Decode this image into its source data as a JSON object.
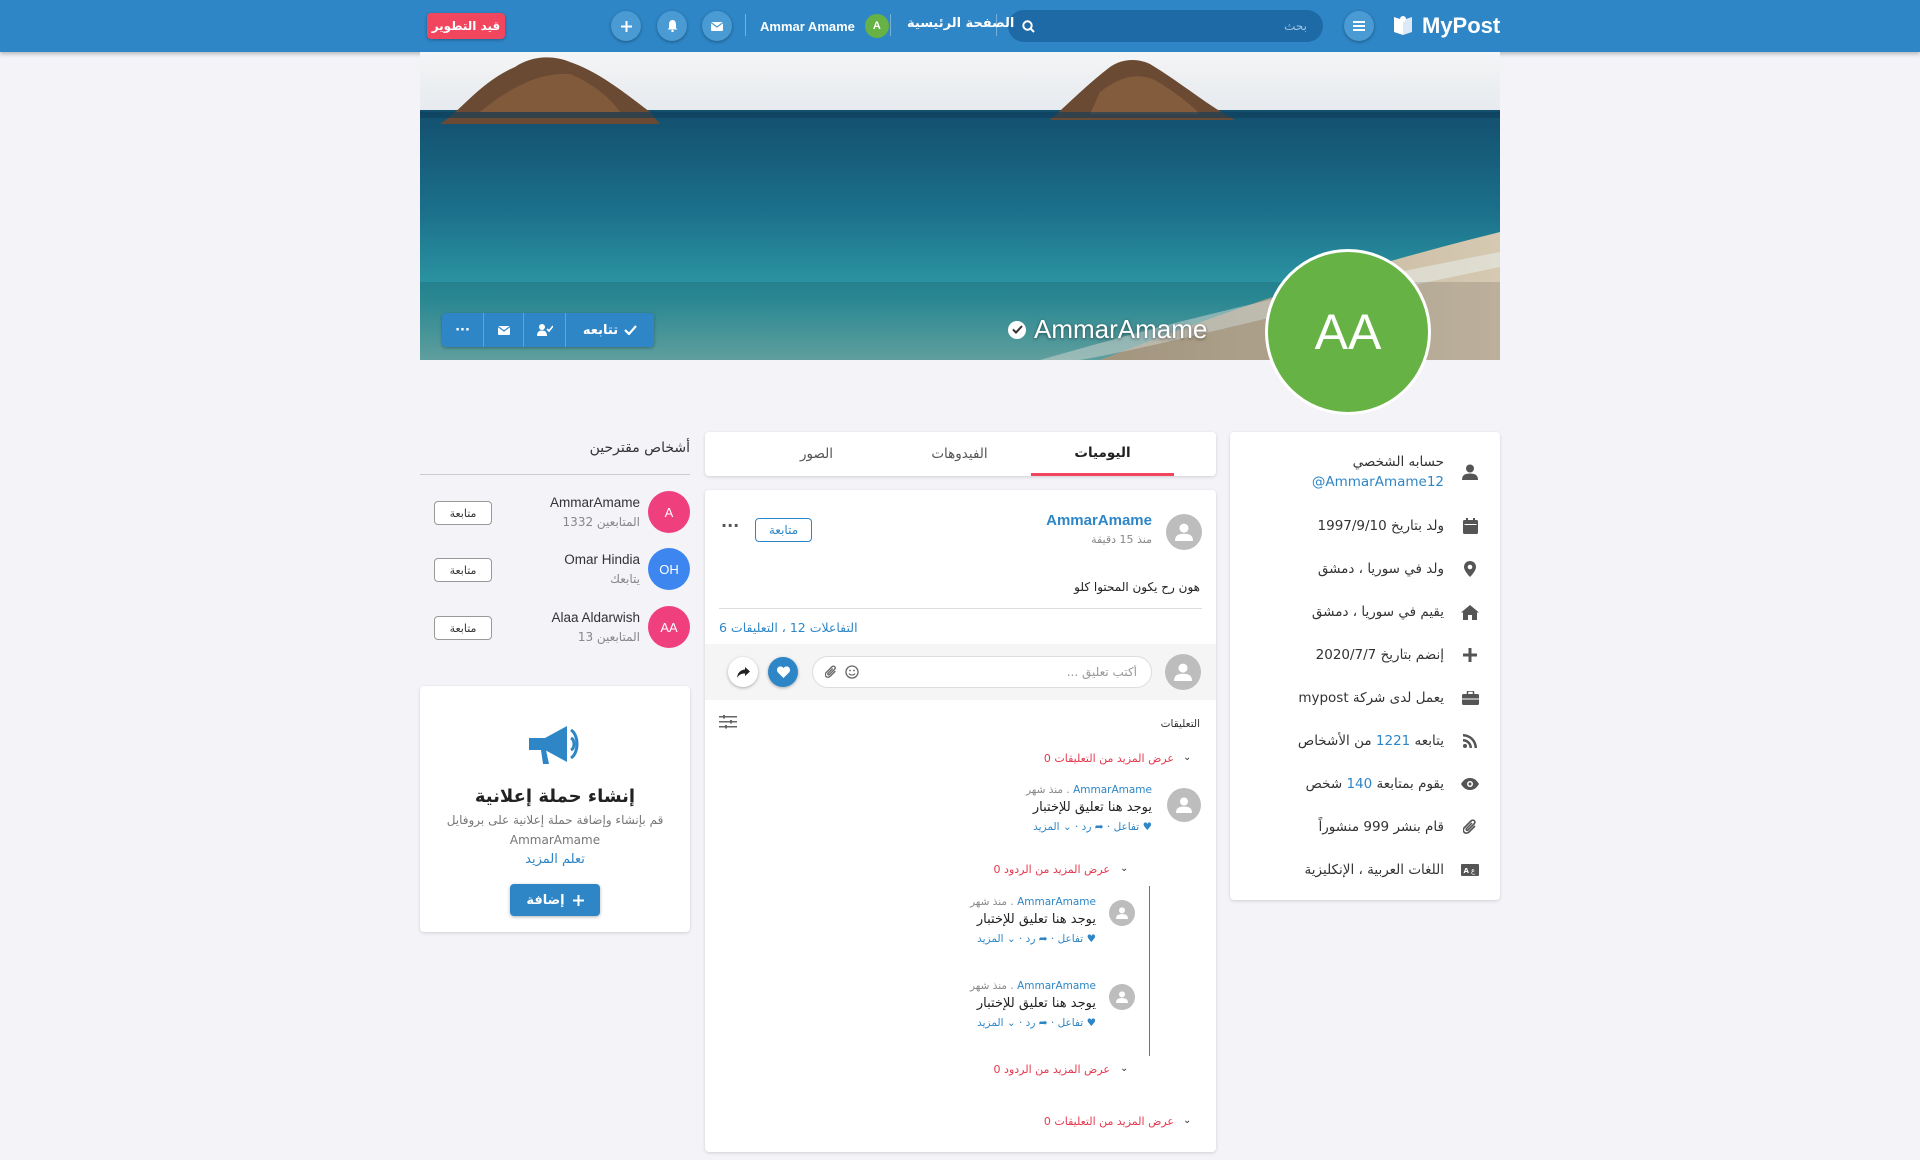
{
  "topbar": {
    "logo": "MyPost",
    "search_placeholder": "بحث",
    "home_link": "الصفحة الرئيسية",
    "user_name": "Ammar Amame",
    "user_initial": "A",
    "dev_badge": "قيد التطوير"
  },
  "cover": {
    "name": "AmmarAmame",
    "avatar_initials": "AA",
    "follow_label": "تتابعه",
    "more_label": "···"
  },
  "profile_info": {
    "account_label": "حسابه الشخصي",
    "handle": "AmmarAmame12@",
    "birth": "ولد بتاريخ 1997/9/10",
    "born_in": "ولد في سوريا ، دمشق",
    "lives_in": "يقيم في سوريا ، دمشق",
    "joined": "إنضم بتاريخ 2020/7/7",
    "works_at": "يعمل لدى شركة mypost",
    "following_pre": "يتابعه",
    "following_count": "1221",
    "following_post": "من الأشخاص",
    "followers_pre": "يقوم بمتابعة",
    "followers_count": "140",
    "followers_post": "شخص",
    "posts": "قام بنشر 999 منشوراً",
    "languages": "اللغات العربية ، الإنكليزية"
  },
  "tabs": [
    "اليوميات",
    "الفيدوهات",
    "الصور"
  ],
  "post": {
    "author": "AmmarAmame",
    "time": "منذ 15 دقيقة",
    "follow_label": "متابعة",
    "content": "هون رح يكون المحتوا كلو",
    "stats": "التفاعلات 12 ، التعليقات 6",
    "comment_placeholder": "أكتب تعليق ...",
    "comments_title": "التعليقات",
    "more_comments": "عرض المزيد من التعليقات 0",
    "more_replies": "عرض المزيد من الردود 0",
    "comment": {
      "user": "AmmarAmame",
      "time": "منذ شهر",
      "text": "يوجد هنا تعليق للإختبار",
      "react": "تفاعل",
      "reply": "رد",
      "more": "المزيد"
    }
  },
  "suggestions": {
    "title": "أشخاص مقترحين",
    "follow_label": "متابعة",
    "people": [
      {
        "initials": "A",
        "name": "AmmarAmame",
        "sub": "المتابعين 1332",
        "color": "#ef3f7c"
      },
      {
        "initials": "OH",
        "name": "Omar Hindia",
        "sub": "يتابعك",
        "color": "#3d86f0"
      },
      {
        "initials": "AA",
        "name": "Alaa Aldarwish",
        "sub": "المتابعين 13",
        "color": "#ef3f7c"
      }
    ]
  },
  "ad": {
    "title": "إنشاء حملة إعلانية",
    "desc": "قم بإنشاء وإضافة حملة إعلانية على بروفايل AmmarAmame",
    "learn": "تعلم المزيد",
    "add_label": "إضافة"
  },
  "colors": {
    "primary": "#2e86c6",
    "accent_red": "#f2455e",
    "avatar_green": "#66b245"
  }
}
